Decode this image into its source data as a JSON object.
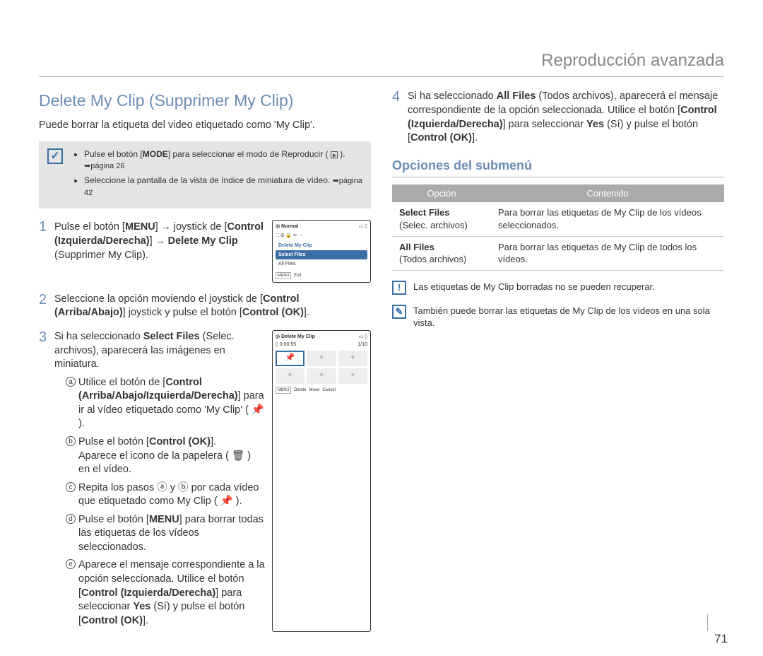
{
  "header": {
    "title": "Reproducción avanzada"
  },
  "page_num": "71",
  "left": {
    "title": "Delete My Clip (Supprimer My Clip)",
    "subtitle": "Puede borrar la etiqueta del video etiquetado como 'My Clip'.",
    "notebox": {
      "bullets": [
        {
          "text_pre": "Pulse el botón [",
          "bold": "MODE",
          "text_post": "] para seleccionar el modo de Reproducir ( ",
          "play": true,
          "close": " ). ",
          "pageref": "➥página 26"
        },
        {
          "text_pre": "Seleccione la pantalla de la vista de índice de miniatura de vídeo. ",
          "pageref": "➥página 42"
        }
      ]
    },
    "steps": [
      {
        "num": "1",
        "lines": [
          "Pulse el botón [<b>MENU</b>] <span class='arrow'>→</span> joystick de [<b>Control (Izquierda/Derecha)</b>] <span class='arrow'>→</span> <b>Delete My Clip</b> (Supprimer My Clip)."
        ],
        "screen": {
          "title": "Normal",
          "items": [
            "Delete My Clip",
            "Select Files",
            "All Files"
          ],
          "sel_index": 1,
          "footer": [
            "MENU",
            "Exit"
          ]
        }
      },
      {
        "num": "2",
        "lines": [
          "Seleccione la opción moviendo el joystick de [<b>Control (Arriba/Abajo)</b>] joystick y pulse el botón [<b>Control (OK)</b>]."
        ]
      },
      {
        "num": "3",
        "lines": [
          "Si ha seleccionado <b>Select Files</b> (Selec. archivos), aparecerá las imágenes en miniatura."
        ],
        "screen": {
          "title": "Delete My Clip",
          "time": "0:00:55",
          "counter": "1/10",
          "thumb_mode": true,
          "footer": [
            "MENU",
            "Delete",
            "",
            "Move",
            "",
            "Cancel"
          ]
        },
        "letters": [
          {
            "l": "a",
            "html": "Utilice el botón de [<b>Control (Arriba/Abajo/Izquierda/Derecha)</b>] para ir al vídeo etiquetado como 'My Clip' ( 📌 )."
          },
          {
            "l": "b",
            "html": "Pulse el botón [<b>Control (OK)</b>].<br>Aparece el icono de la papelera ( 🗑 ) en el vídeo."
          },
          {
            "l": "c",
            "html": "Repita los pasos ⓐ y ⓑ por cada vídeo que etiquetado como My Clip ( 📌 )."
          },
          {
            "l": "d",
            "html": "Pulse el botón [<b>MENU</b>] para borrar todas las etiquetas de los vídeos seleccionados."
          },
          {
            "l": "e",
            "html": "Aparece el mensaje correspondiente a la opción seleccionada. Utilice el botón [<b>Control (Izquierda/Derecha)</b>] para seleccionar <b>Yes</b> (Sí) y pulse el botón [<b>Control (OK)</b>]."
          }
        ]
      }
    ]
  },
  "right": {
    "step4": {
      "num": "4",
      "html": "Si ha seleccionado <b>All Files</b> (Todos archivos), aparecerá el mensaje correspondiente de la opción seleccionada. Utilice el botón [<b>Control (Izquierda/Derecha)</b>] para seleccionar <b>Yes</b> (Sí) y pulse el botón [<b>Control (OK)</b>]."
    },
    "sub_head": "Opciones del submenú",
    "table": {
      "headers": [
        "Opción",
        "Contenido"
      ],
      "rows": [
        {
          "name": "Select Files",
          "sub": "(Selec. archivos)",
          "desc": "Para borrar las etiquetas de My Clip de los vídeos seleccionados."
        },
        {
          "name": "All Files",
          "sub": "(Todos archivos)",
          "desc": "Para borrar las etiquetas de My Clip de todos los vídeos."
        }
      ]
    },
    "warnings": [
      {
        "icon": "!",
        "text": "Las etiquetas de My Clip borradas no se pueden recuperar."
      },
      {
        "icon": "✎",
        "text": "También puede borrar las etiquetas de My Clip de los vídeos en una sola vista."
      }
    ]
  }
}
